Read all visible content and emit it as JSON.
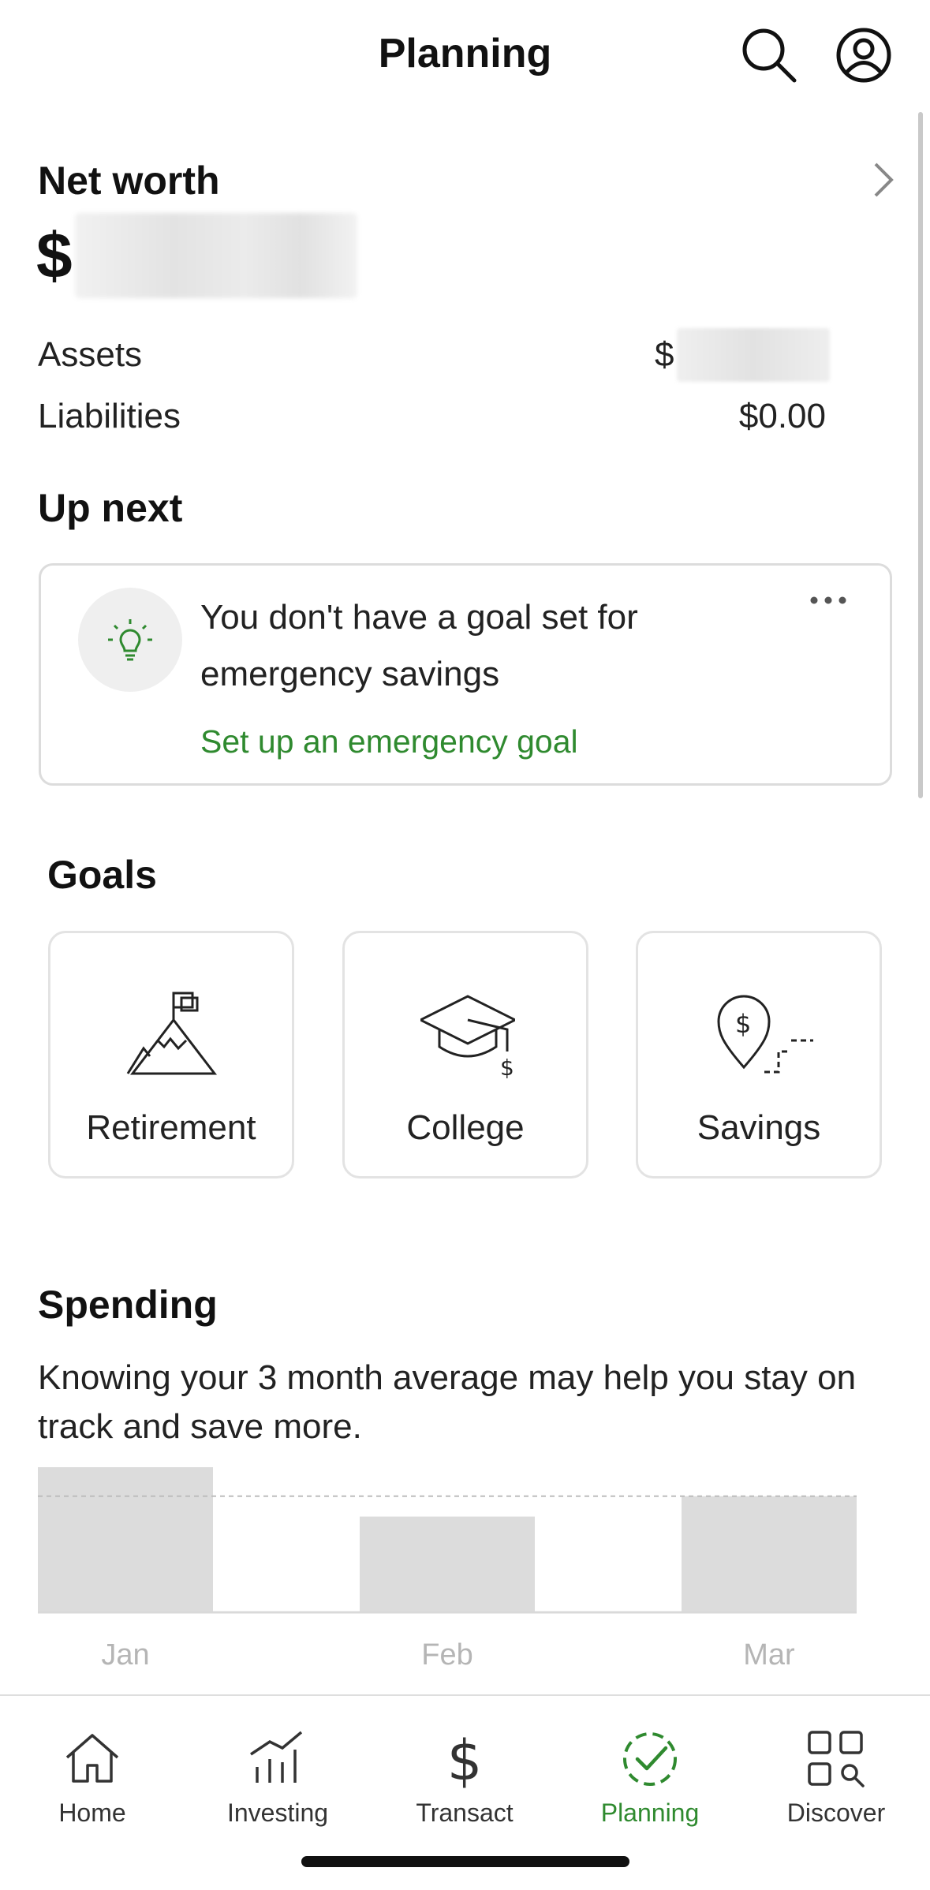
{
  "header": {
    "title": "Planning"
  },
  "net_worth": {
    "title": "Net worth",
    "currency_symbol": "$",
    "assets_label": "Assets",
    "assets_symbol": "$",
    "liabilities_label": "Liabilities",
    "liabilities_value": "$0.00"
  },
  "up_next": {
    "title": "Up next",
    "card_text": "You don't have a goal set for emergency savings",
    "link_text": "Set up an emergency goal"
  },
  "goals": {
    "title": "Goals",
    "items": [
      {
        "label": "Retirement",
        "icon": "mountain-flag-icon"
      },
      {
        "label": "College",
        "icon": "graduation-cap-icon"
      },
      {
        "label": "Savings",
        "icon": "location-dollar-icon"
      }
    ]
  },
  "spending": {
    "title": "Spending",
    "description": "Knowing your 3 month average may help you stay on track and save more."
  },
  "chart_data": {
    "type": "bar",
    "categories": [
      "Jan",
      "Feb",
      "Mar"
    ],
    "values": [
      1.0,
      0.66,
      0.8
    ],
    "average": 0.8,
    "ylim": [
      0,
      1.0
    ],
    "grid": false,
    "colors": {
      "bar": "#dcdcdc",
      "average_line": "#bdbdbd",
      "axis": "#d9d9d9",
      "tick": "#b5b5b5"
    }
  },
  "tabbar": {
    "items": [
      {
        "label": "Home"
      },
      {
        "label": "Investing"
      },
      {
        "label": "Transact"
      },
      {
        "label": "Planning"
      },
      {
        "label": "Discover"
      }
    ]
  },
  "colors": {
    "accent": "#2f8a2f",
    "card_border": "#dcdcdc"
  }
}
